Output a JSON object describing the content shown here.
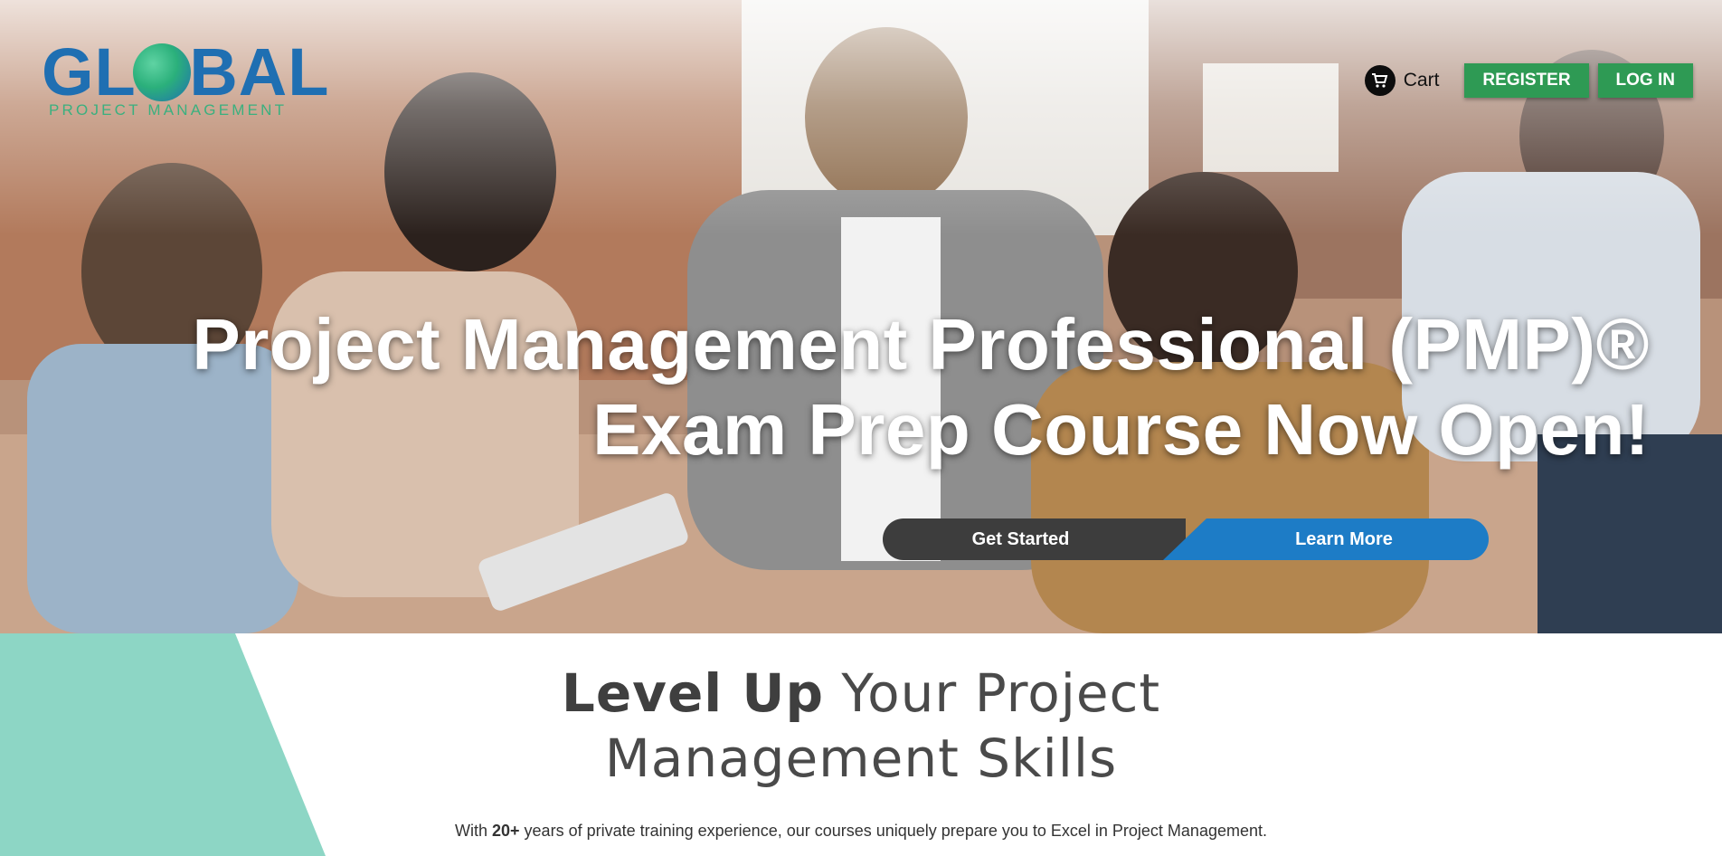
{
  "brand": {
    "logo_main": "GLOBAL",
    "logo_sub": "PROJECT MANAGEMENT",
    "colors": {
      "primary": "#1f6fb2",
      "accent": "#3ab07f"
    }
  },
  "header": {
    "cart_icon": "shopping-cart-icon",
    "cart_label": "Cart",
    "register_label": "REGISTER",
    "login_label": "LOG IN",
    "button_color": "#2e9a54"
  },
  "hero": {
    "title_line1": "Project Management Professional (PMP)®",
    "title_line2": "Exam Prep Course Now Open!",
    "get_started_label": "Get Started",
    "learn_more_label": "Learn More",
    "get_started_color": "#3d3d3d",
    "learn_more_color": "#1d7cc6"
  },
  "section": {
    "title_strong": "Level Up",
    "title_rest": " Your Project",
    "title_line2": "Management Skills",
    "body_prefix": "With ",
    "body_strong": "20+",
    "body_rest": " years of private training experience, our courses uniquely prepare you to Excel in Project Management.",
    "accent_color": "#8dd6c5"
  }
}
